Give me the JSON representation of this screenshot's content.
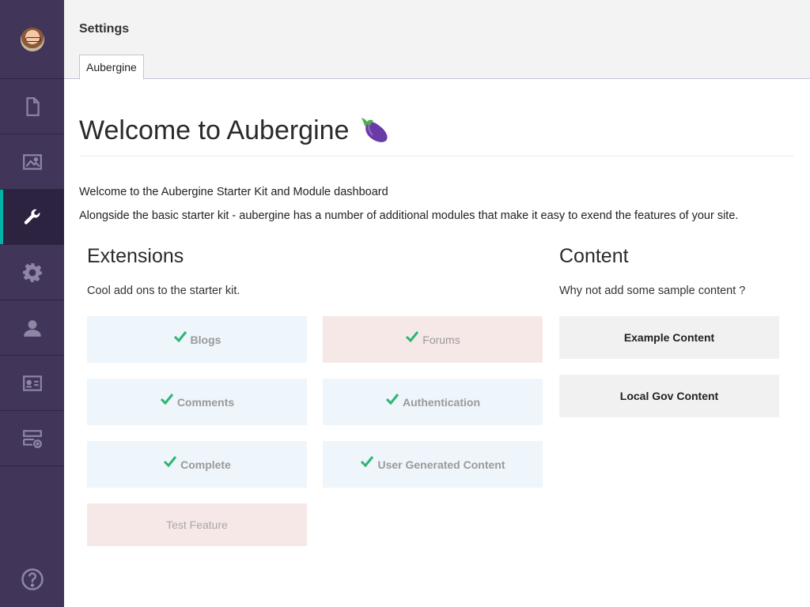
{
  "header": {
    "title": "Settings",
    "tab": "Aubergine"
  },
  "page": {
    "title": "Welcome to Aubergine",
    "intro1": "Welcome to the Aubergine Starter Kit and Module dashboard",
    "intro2": "Alongside the basic starter kit - aubergine has a number of additional modules that make it easy to exend the features of your site."
  },
  "extensions": {
    "heading": "Extensions",
    "subtitle": "Cool add ons to the starter kit.",
    "items": [
      {
        "label": "Blogs",
        "installed": true,
        "color": "blue"
      },
      {
        "label": "Forums",
        "installed": true,
        "color": "pink"
      },
      {
        "label": "Comments",
        "installed": true,
        "color": "blue"
      },
      {
        "label": "Authentication",
        "installed": true,
        "color": "blue"
      },
      {
        "label": "Complete",
        "installed": true,
        "color": "blue"
      },
      {
        "label": "User Generated Content",
        "installed": true,
        "color": "blue"
      },
      {
        "label": "Test Feature",
        "installed": false,
        "color": "pink"
      }
    ]
  },
  "content": {
    "heading": "Content",
    "subtitle": "Why not add some sample content ?",
    "buttons": [
      "Example Content",
      "Local Gov Content"
    ]
  },
  "sidebar": {
    "icons": [
      "document-icon",
      "image-icon",
      "wrench-icon",
      "gear-icon",
      "user-icon",
      "id-card-icon",
      "add-content-icon"
    ],
    "active": "wrench-icon",
    "help_icon": "help-icon"
  },
  "colors": {
    "sidebar": "#413659",
    "accent": "#00b5a5",
    "check": "#2bb673",
    "card_blue": "#eef5fb",
    "card_pink": "#f7e8e8"
  }
}
